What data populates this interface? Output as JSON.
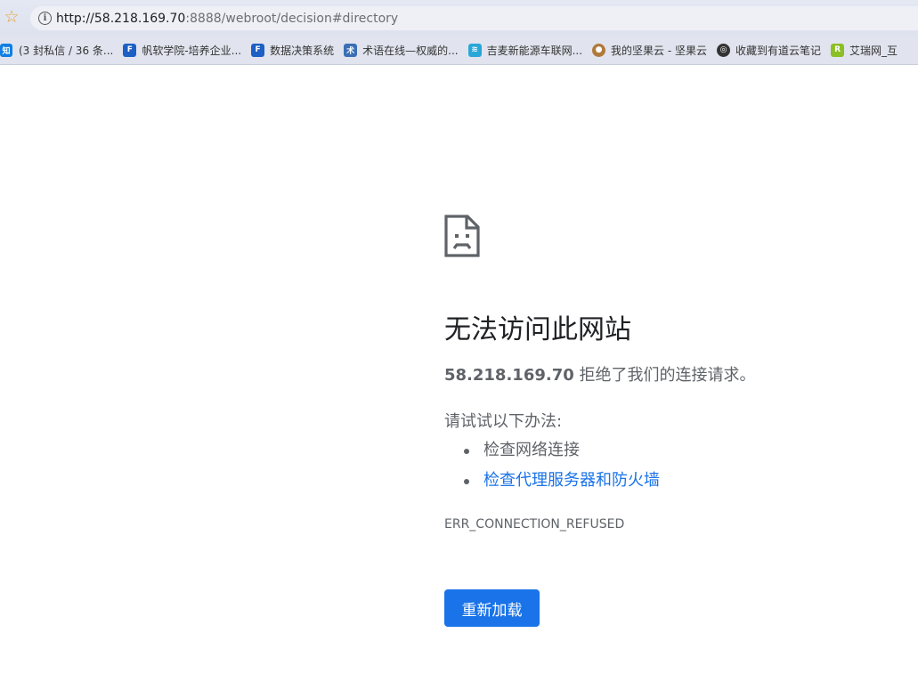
{
  "browser": {
    "url_host": "http://58.218.169.70",
    "url_path": ":8888/webroot/decision#directory",
    "bookmarks": [
      {
        "label": "(3 封私信 / 36 条...",
        "icon_text": "知",
        "icon_color": "#0f7fe3"
      },
      {
        "label": "帆软学院-培养企业...",
        "icon_text": "F",
        "icon_color": "#1d5fc4"
      },
      {
        "label": "数据决策系统",
        "icon_text": "F",
        "icon_color": "#1d5fc4"
      },
      {
        "label": "术语在线—权威的...",
        "icon_text": "术",
        "icon_color": "#3a6fb5"
      },
      {
        "label": "吉麦新能源车联网...",
        "icon_text": "≋",
        "icon_color": "#2aa6d8"
      },
      {
        "label": "我的坚果云 - 坚果云",
        "icon_text": "●",
        "icon_color": "#b07a3a"
      },
      {
        "label": "收藏到有道云笔记",
        "icon_text": "◎",
        "icon_color": "#333333"
      },
      {
        "label": "艾瑞网_互",
        "icon_text": "R",
        "icon_color": "#8cbf26"
      }
    ]
  },
  "error_page": {
    "headline": "无法访问此网站",
    "host": "58.218.169.70",
    "refused_text": " 拒绝了我们的连接请求。",
    "try_title": "请试试以下办法:",
    "suggestions": [
      "检查网络连接",
      "检查代理服务器和防火墙"
    ],
    "error_code": "ERR_CONNECTION_REFUSED",
    "reload_label": "重新加载"
  },
  "colors": {
    "link": "#1a73e8",
    "button": "#1a73e8",
    "text_secondary": "#5f6368"
  },
  "icons": {
    "bookmark_star": "star-icon",
    "site_info": "info-icon",
    "error_illustration": "sad-page-icon"
  }
}
